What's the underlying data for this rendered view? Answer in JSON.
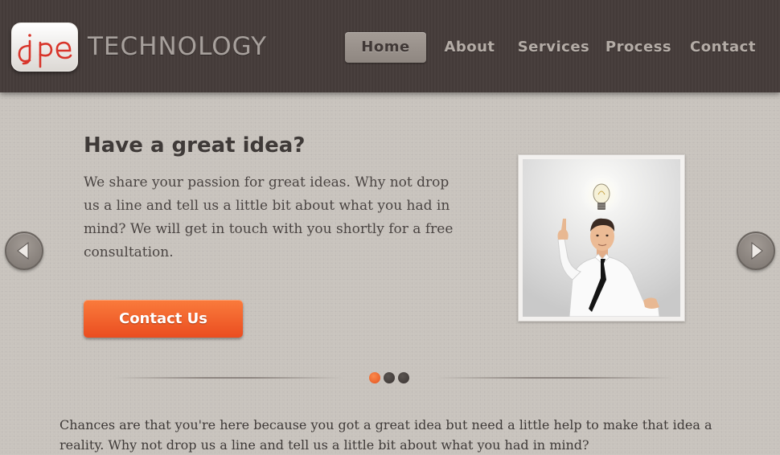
{
  "header": {
    "logo_text": "jpe",
    "brand": "TECHNOLOGY",
    "nav": [
      {
        "label": "Home",
        "active": true
      },
      {
        "label": "About",
        "active": false
      },
      {
        "label": "Services",
        "active": false
      },
      {
        "label": "Process",
        "active": false
      },
      {
        "label": "Contact",
        "active": false
      }
    ]
  },
  "slider": {
    "title": "Have a great idea?",
    "body": "We share your passion for great ideas. Why not drop us a line and tell us a little bit about what you had in mind? We will get in touch with you shortly for a free consultation.",
    "cta_label": "Contact Us",
    "prev_icon": "chevron-left-icon",
    "next_icon": "chevron-right-icon",
    "image": "man-with-lightbulb-photo",
    "dots": [
      {
        "active": true
      },
      {
        "active": false
      },
      {
        "active": false
      }
    ]
  },
  "intro": {
    "text": "Chances are that you're here because you got a great idea but need a little help to make that idea a reality. Why not drop us a line and tell us a little bit about what you had in mind?"
  },
  "colors": {
    "header_bg": "#463d3b",
    "page_bg": "#c8c3bd",
    "accent": "#f15f2a",
    "logo_red": "#d8342a"
  }
}
